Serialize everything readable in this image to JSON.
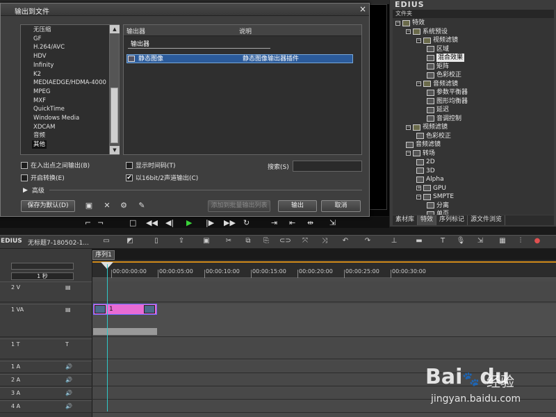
{
  "dialog": {
    "title": "输出到文件",
    "close": "×",
    "formats": [
      "无压缩",
      "GF",
      "H.264/AVC",
      "HDV",
      "Infinity",
      "K2",
      "MEDIAEDGE/HDMA-4000",
      "MPEG",
      "MXF",
      "QuickTime",
      "Windows Media",
      "XDCAM",
      "音频",
      "其他"
    ],
    "selected_format": "其他",
    "exporter_columns": {
      "name": "输出器",
      "description": "说明"
    },
    "exporter_group": "输出器",
    "exporters": [
      {
        "name": "静态图像",
        "description": "静态图像输出器插件"
      }
    ],
    "options": {
      "in_out_only": "在入出点之间输出(B)",
      "show_timecode": "显示时间码(T)",
      "enable_conversion": "开启转换(E)",
      "output_16bit": "以16bit/2声道输出(C)"
    },
    "option_checked": {
      "output_16bit": "✔"
    },
    "search_label": "搜索(S)",
    "search_value": "",
    "advanced": "高级",
    "buttons": {
      "save_default": "保存为默认(D)",
      "add_batch": "添加到批量输出列表",
      "export": "输出",
      "cancel": "取消"
    }
  },
  "right_panel": {
    "logo": "EDIUS",
    "folder_header": "文件夹",
    "tree": [
      {
        "label": "特效",
        "level": 0,
        "kind": "folder",
        "exp": "−"
      },
      {
        "label": "系统预设",
        "level": 1,
        "kind": "folder",
        "exp": "−"
      },
      {
        "label": "视频滤镜",
        "level": 2,
        "kind": "folder",
        "exp": "−"
      },
      {
        "label": "区域",
        "level": 3,
        "kind": "fx"
      },
      {
        "label": "混合效果",
        "level": 3,
        "kind": "fx",
        "selected": true
      },
      {
        "label": "矩阵",
        "level": 3,
        "kind": "fx"
      },
      {
        "label": "色彩校正",
        "level": 3,
        "kind": "fx"
      },
      {
        "label": "音频滤镜",
        "level": 2,
        "kind": "folder",
        "exp": "−"
      },
      {
        "label": "参数平衡器",
        "level": 3,
        "kind": "fx"
      },
      {
        "label": "图形均衡器",
        "level": 3,
        "kind": "fx"
      },
      {
        "label": "延迟",
        "level": 3,
        "kind": "fx"
      },
      {
        "label": "音调控制",
        "level": 3,
        "kind": "fx"
      },
      {
        "label": "视频滤镜",
        "level": 1,
        "kind": "folder",
        "exp": "−"
      },
      {
        "label": "色彩校正",
        "level": 2,
        "kind": "fx"
      },
      {
        "label": "音频滤镜",
        "level": 1,
        "kind": "fx"
      },
      {
        "label": "转场",
        "level": 1,
        "kind": "fx",
        "exp": "−"
      },
      {
        "label": "2D",
        "level": 2,
        "kind": "fx"
      },
      {
        "label": "3D",
        "level": 2,
        "kind": "fx"
      },
      {
        "label": "Alpha",
        "level": 2,
        "kind": "fx"
      },
      {
        "label": "GPU",
        "level": 2,
        "kind": "fx",
        "exp": "+"
      },
      {
        "label": "SMPTE",
        "level": 2,
        "kind": "fx",
        "exp": "−"
      },
      {
        "label": "分离",
        "level": 3,
        "kind": "fx"
      },
      {
        "label": "单页",
        "level": 3,
        "kind": "fx"
      }
    ],
    "tabs": [
      "素材库",
      "特效",
      "序列标记",
      "源文件浏览"
    ],
    "active_tab": "特效"
  },
  "timeline": {
    "logo": "EDIUS",
    "project": "无标题7-180502-1...",
    "sequence_tab": "序列1",
    "zoom": "1 秒",
    "ticks": [
      "00:00:00:00",
      "00:00:05:00",
      "00:00:10:00",
      "00:00:15:00",
      "00:00:20:00",
      "00:00:25:00",
      "00:00:30:00"
    ],
    "tracks": [
      {
        "name": "2 V"
      },
      {
        "name": "1 VA"
      },
      {
        "name": "1 T"
      },
      {
        "name": "1 A"
      },
      {
        "name": "2 A"
      },
      {
        "name": "3 A"
      },
      {
        "name": "4 A"
      }
    ],
    "clip_label": "1"
  },
  "watermark": {
    "brand": "Bai",
    "brand2": "du",
    "jingyan": "经验",
    "url": "jingyan.baidu.com"
  }
}
